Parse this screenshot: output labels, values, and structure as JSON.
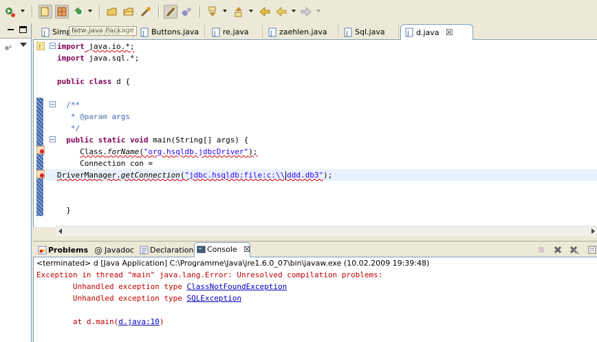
{
  "toolbar": {
    "buttons": [
      "debug-run",
      "new-java-package",
      "new-java-class",
      "run-external",
      "open-type",
      "open-resource",
      "search",
      "toggle-mark-occurrences",
      "toggle-breadcrumb",
      "next-annotation",
      "previous-annotation",
      "back",
      "forward"
    ]
  },
  "tooltip": "New Java Package",
  "editor_tabs": [
    {
      "label": "SimpleFrame.java"
    },
    {
      "label": "Buttons.java"
    },
    {
      "label": "re.java"
    },
    {
      "label": "zaehlen.java"
    },
    {
      "label": "Sql.java"
    },
    {
      "label": "d.java",
      "close": "☒"
    }
  ],
  "code": {
    "l1_kw": "import",
    "l1_rest": " java.io.*;",
    "l2_kw": "import",
    "l2_rest": " java.sql.*;",
    "l3_kw1": "public",
    "l3_kw2": "class",
    "l3_rest": " d {",
    "l4": "  /**",
    "l5_pre": "   * ",
    "l5_tag": "@param",
    "l5_rest": " args",
    "l6": "   */",
    "l7_kw1": "public",
    "l7_kw2": "static",
    "l7_kw3": "void",
    "l7_rest": " main(String[] args) {",
    "l8_a": "Class.",
    "l8_method": "forName",
    "l8_b": "(",
    "l8_str": "\"org.hsqldb.jdbcDriver\"",
    "l8_c": ");",
    "l9": "Connection con =",
    "l10_a": "DriverManager.",
    "l10_method": "getConnection",
    "l10_b": "(",
    "l10_str1": "\"jdbc.hsqldb:file:c:\\\\",
    "l10_str2": "ddd.db3\"",
    "l10_c": ");",
    "l11": "  }"
  },
  "bottom_tabs": {
    "problems": "Problems",
    "javadoc": "Javadoc",
    "declaration": "Declaration",
    "console": "Console",
    "console_close": "☒"
  },
  "console": {
    "status": "<terminated> d [Java Application] C:\\Programme\\Java\\jre1.6.0_07\\bin\\javaw.exe (10.02.2009 19:39:48)",
    "line1": "Exception in thread \"main\" java.lang.Error: Unresolved compilation problems:",
    "line2_pre": "        Unhandled exception type ",
    "line2_link": "ClassNotFoundException",
    "line3_pre": "        Unhandled exception type ",
    "line3_link": "SQLException",
    "line5_pre": "        at d.main(",
    "line5_link": "d.java:10",
    "line5_post": ")"
  },
  "colors": {
    "keyword": "#7f0055",
    "string": "#2a00ff",
    "comment": "#3f5fbf",
    "error": "#c00000",
    "link": "#0000c0"
  }
}
